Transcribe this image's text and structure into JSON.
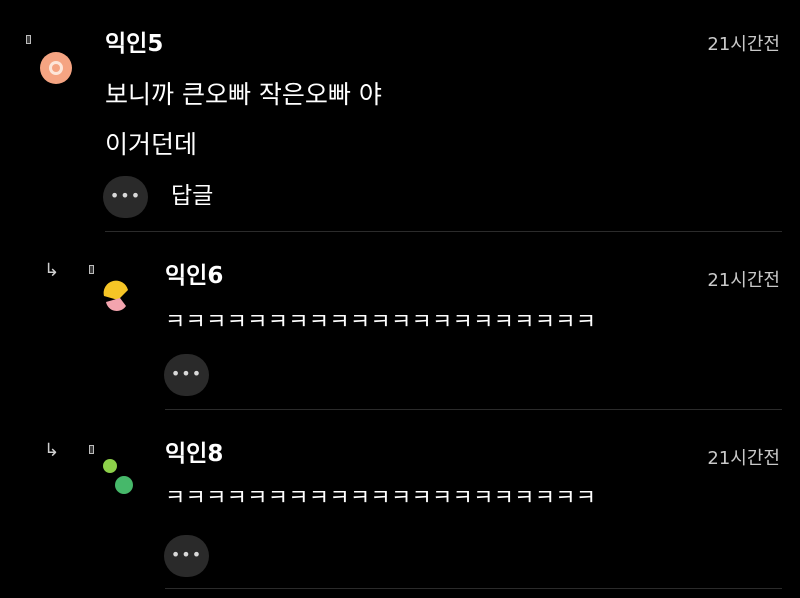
{
  "comments": [
    {
      "name": "익인5",
      "time": "21시간전",
      "lines": [
        "보니까 큰오빠 작은오빠 야",
        "이거던데"
      ],
      "more_label": "•••",
      "reply_label": "답글",
      "avatar_icon": "orange-circle-avatar"
    },
    {
      "name": "익인6",
      "time": "21시간전",
      "lines": [
        "ㅋㅋㅋㅋㅋㅋㅋㅋㅋㅋㅋㅋㅋㅋㅋㅋㅋㅋㅋㅋㅋ"
      ],
      "more_label": "•••",
      "avatar_icon": "yellow-pink-avatar"
    },
    {
      "name": "익인8",
      "time": "21시간전",
      "lines": [
        "ㅋㅋㅋㅋㅋㅋㅋㅋㅋㅋㅋㅋㅋㅋㅋㅋㅋㅋㅋㅋㅋ"
      ],
      "more_label": "•••",
      "avatar_icon": "green-dots-avatar"
    }
  ],
  "icons": {
    "reply_arrow": "↳",
    "marker": "small-rectangle-marker"
  },
  "colors": {
    "background": "#000000",
    "text": "#ffffff",
    "time": "#c9c9c9",
    "button_bg": "#2a2a2a",
    "divider": "#2b2b2b"
  }
}
